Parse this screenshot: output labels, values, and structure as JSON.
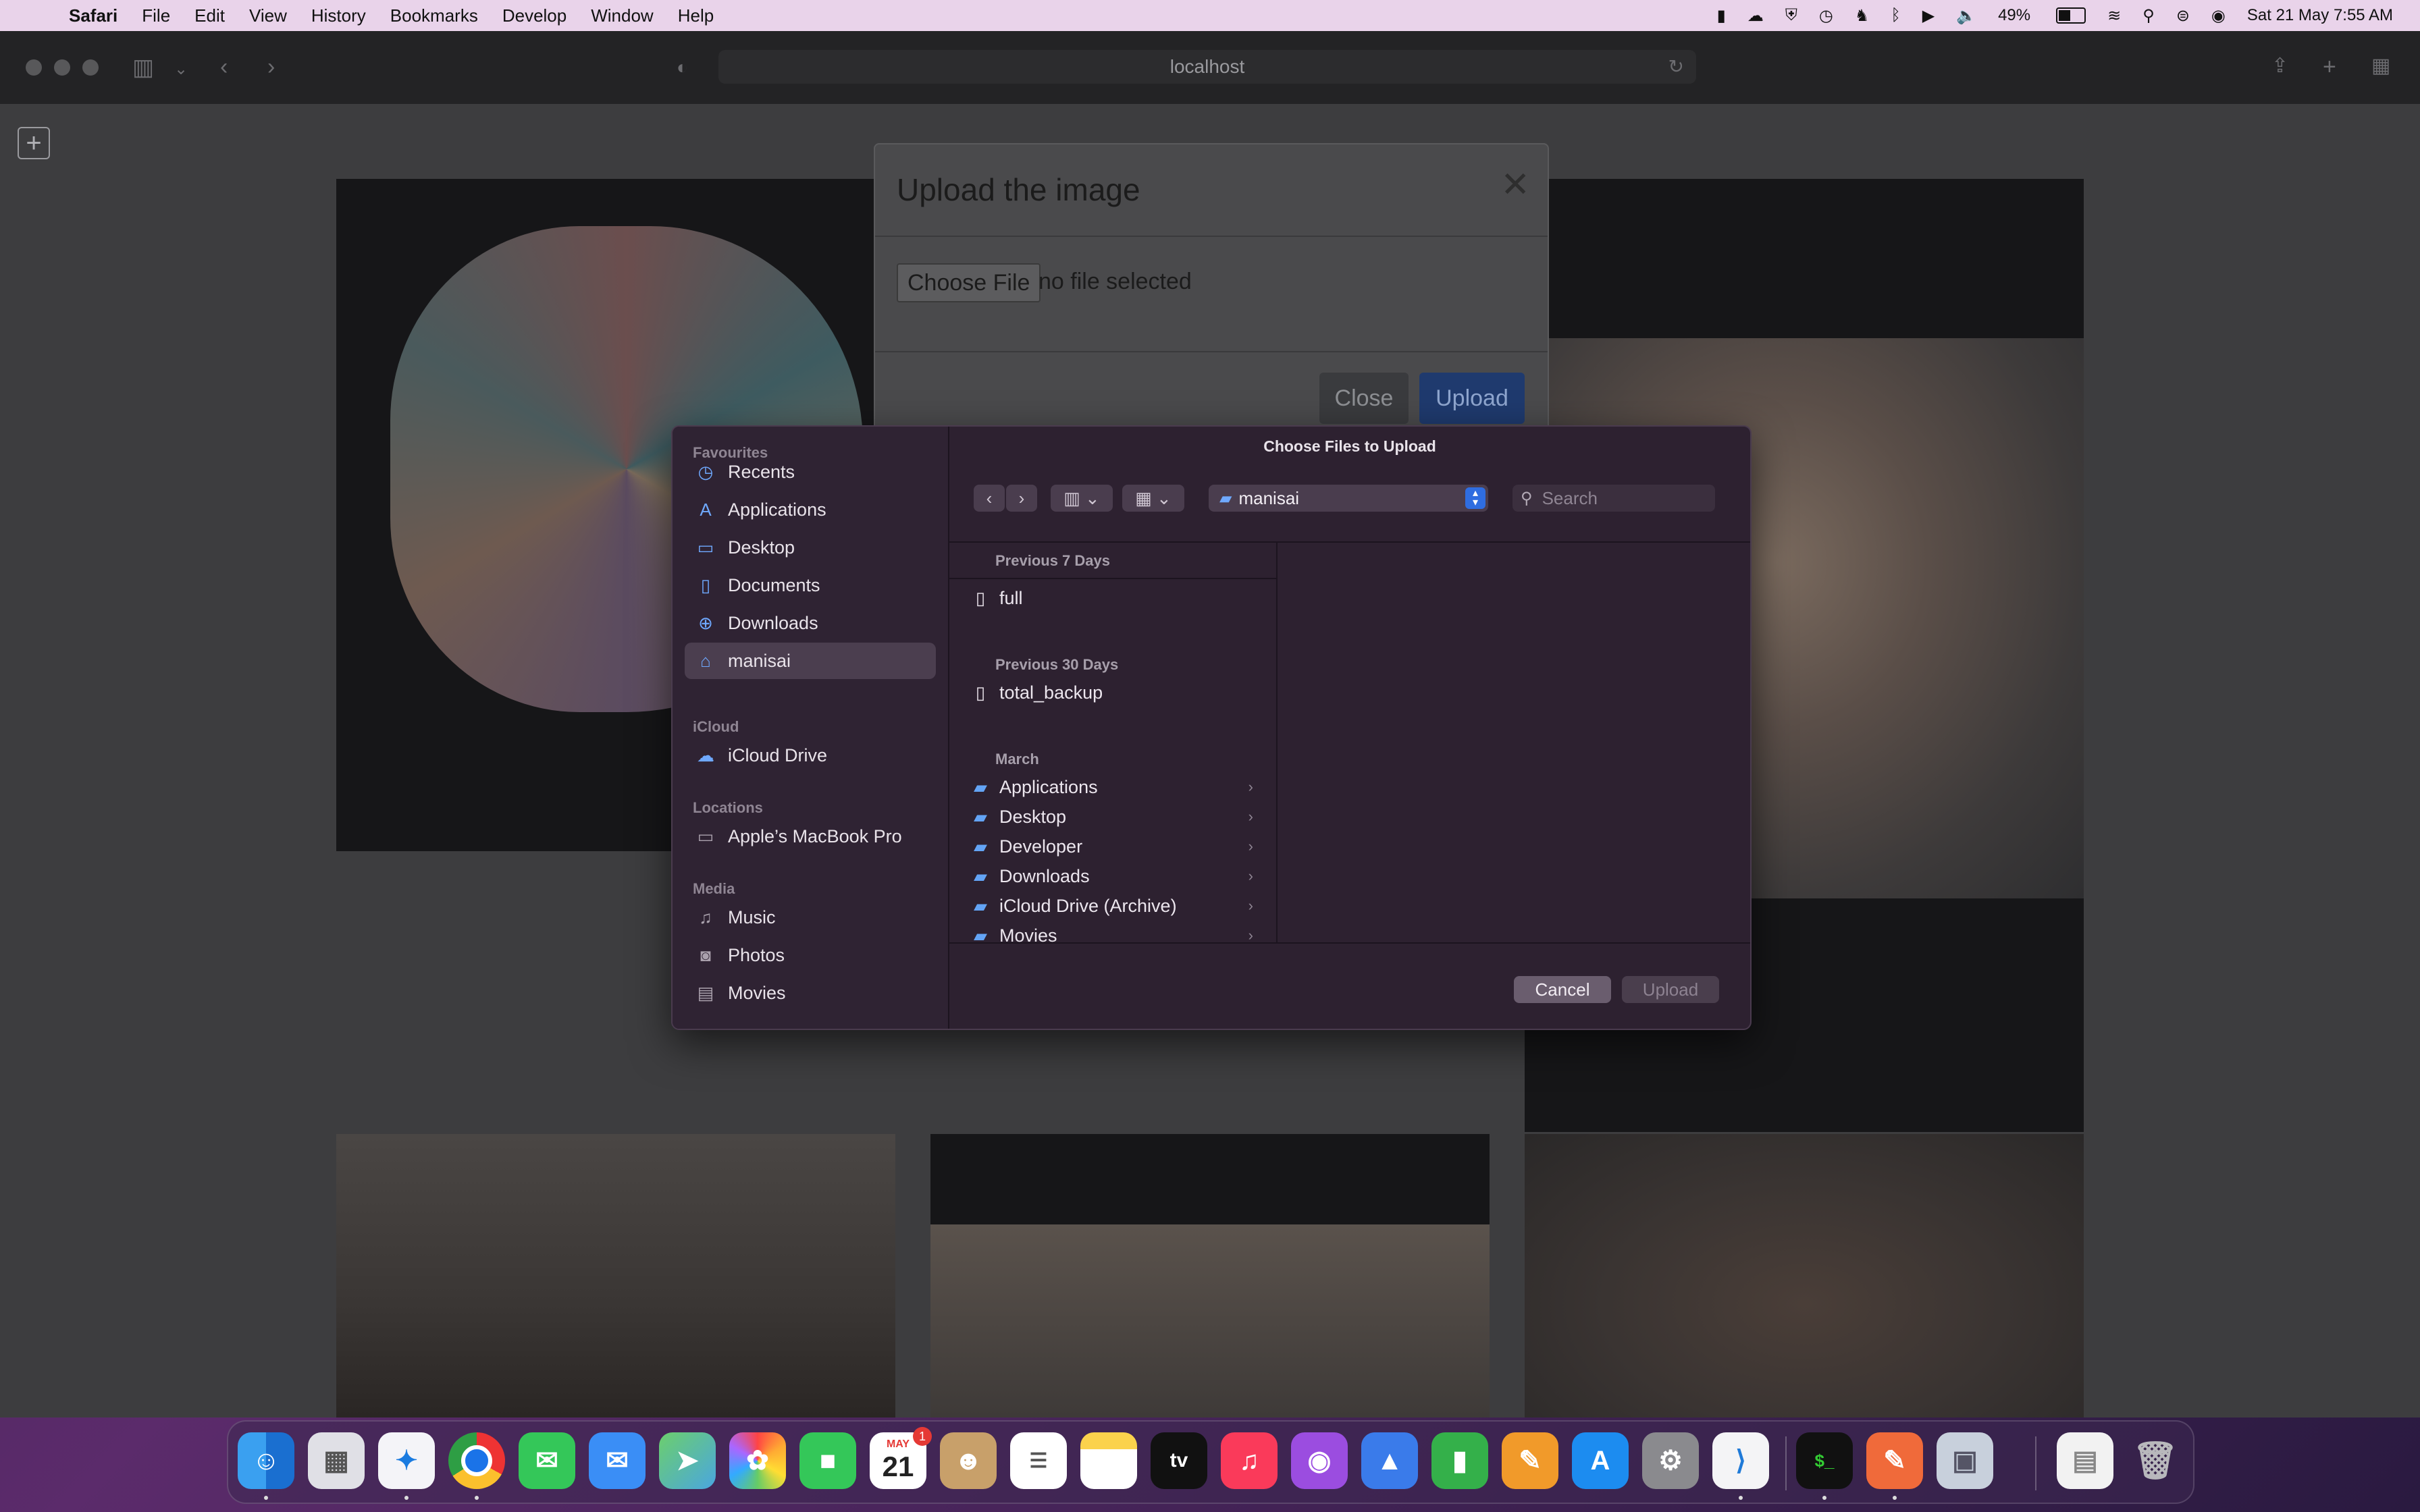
{
  "menubar": {
    "app_name": "Safari",
    "items": [
      "File",
      "Edit",
      "View",
      "History",
      "Bookmarks",
      "Develop",
      "Window",
      "Help"
    ],
    "battery_percent": "49%",
    "datetime": "Sat 21 May  7:55 AM"
  },
  "browser": {
    "address": "localhost"
  },
  "modal": {
    "title": "Upload the image",
    "choose_file_label": "Choose File",
    "file_status": "no file selected",
    "close_label": "Close",
    "upload_label": "Upload"
  },
  "chooser": {
    "title": "Choose Files to Upload",
    "current_folder": "manisai",
    "search_placeholder": "Search",
    "sidebar": {
      "favourites_label": "Favourites",
      "favourites": [
        {
          "label": "Recents",
          "icon": "clock-icon"
        },
        {
          "label": "Applications",
          "icon": "applications-icon"
        },
        {
          "label": "Desktop",
          "icon": "desktop-icon"
        },
        {
          "label": "Documents",
          "icon": "document-icon"
        },
        {
          "label": "Downloads",
          "icon": "download-icon"
        },
        {
          "label": "manisai",
          "icon": "home-icon"
        }
      ],
      "icloud_label": "iCloud",
      "icloud": [
        {
          "label": "iCloud Drive",
          "icon": "cloud-icon"
        }
      ],
      "locations_label": "Locations",
      "locations": [
        {
          "label": "Apple’s MacBook Pro",
          "icon": "laptop-icon"
        }
      ],
      "media_label": "Media",
      "media": [
        {
          "label": "Music",
          "icon": "music-icon"
        },
        {
          "label": "Photos",
          "icon": "camera-icon"
        },
        {
          "label": "Movies",
          "icon": "film-icon"
        }
      ]
    },
    "groups": [
      {
        "label": "Previous 7 Days",
        "items": [
          {
            "name": "full",
            "kind": "file"
          }
        ]
      },
      {
        "label": "Previous 30 Days",
        "items": [
          {
            "name": "total_backup",
            "kind": "file"
          }
        ]
      },
      {
        "label": "March",
        "items": [
          {
            "name": "Applications",
            "kind": "folder"
          },
          {
            "name": "Desktop",
            "kind": "folder"
          },
          {
            "name": "Developer",
            "kind": "folder"
          },
          {
            "name": "Downloads",
            "kind": "folder"
          },
          {
            "name": "iCloud Drive (Archive)",
            "kind": "folder"
          },
          {
            "name": "Movies",
            "kind": "folder"
          }
        ]
      }
    ],
    "cancel_label": "Cancel",
    "upload_label": "Upload"
  },
  "dock": {
    "apps": [
      "Finder",
      "Launchpad",
      "Safari",
      "Chrome",
      "Messages",
      "Mail",
      "Maps",
      "Photos",
      "FaceTime",
      "Calendar",
      "Contacts",
      "Reminders",
      "Notes",
      "TV",
      "Music",
      "Podcasts",
      "Keynote",
      "Numbers",
      "Pages",
      "App Store",
      "System Preferences",
      "VS Code",
      "Terminal",
      "Sketch",
      "Preview",
      "Document",
      "Trash"
    ],
    "calendar_month": "MAY",
    "calendar_day": "21",
    "calendar_badge": "1"
  },
  "colors": {
    "accent": "#2f6de0",
    "folder": "#63a4f5",
    "sheet_bg": "#2d2130"
  }
}
